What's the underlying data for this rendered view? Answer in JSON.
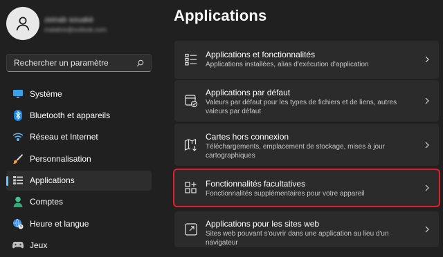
{
  "user": {
    "name": "zeinab souaké",
    "email": "malabre@outlook.com"
  },
  "search": {
    "placeholder": "Rechercher un paramètre"
  },
  "sidebar": {
    "items": [
      {
        "label": "Système",
        "icon": "monitor-icon"
      },
      {
        "label": "Bluetooth et appareils",
        "icon": "bluetooth-icon"
      },
      {
        "label": "Réseau et Internet",
        "icon": "wifi-icon"
      },
      {
        "label": "Personnalisation",
        "icon": "brush-icon"
      },
      {
        "label": "Applications",
        "icon": "apps-icon",
        "selected": true
      },
      {
        "label": "Comptes",
        "icon": "person-icon"
      },
      {
        "label": "Heure et langue",
        "icon": "globe-clock-icon"
      },
      {
        "label": "Jeux",
        "icon": "gamepad-icon"
      }
    ]
  },
  "main": {
    "title": "Applications",
    "cards": [
      {
        "title": "Applications et fonctionnalités",
        "desc": "Applications installées, alias d'exécution d'application",
        "icon": "apps-list-icon"
      },
      {
        "title": "Applications par défaut",
        "desc": "Valeurs par défaut pour les types de fichiers et de liens, autres valeurs par défaut",
        "icon": "default-apps-icon"
      },
      {
        "title": "Cartes hors connexion",
        "desc": "Téléchargements, emplacement de stockage, mises à jour cartographiques",
        "icon": "offline-map-icon"
      },
      {
        "title": "Fonctionnalités facultatives",
        "desc": "Fonctionnalités supplémentaires pour votre appareil",
        "icon": "optional-features-icon",
        "highlighted": true
      },
      {
        "title": "Applications pour les sites web",
        "desc": "Sites web pouvant s'ouvrir dans une application au lieu d'un navigateur",
        "icon": "open-link-icon"
      }
    ]
  },
  "colors": {
    "background": "#202020",
    "card": "#2b2b2b",
    "accent": "#60cdff",
    "highlight": "#e0202a"
  }
}
